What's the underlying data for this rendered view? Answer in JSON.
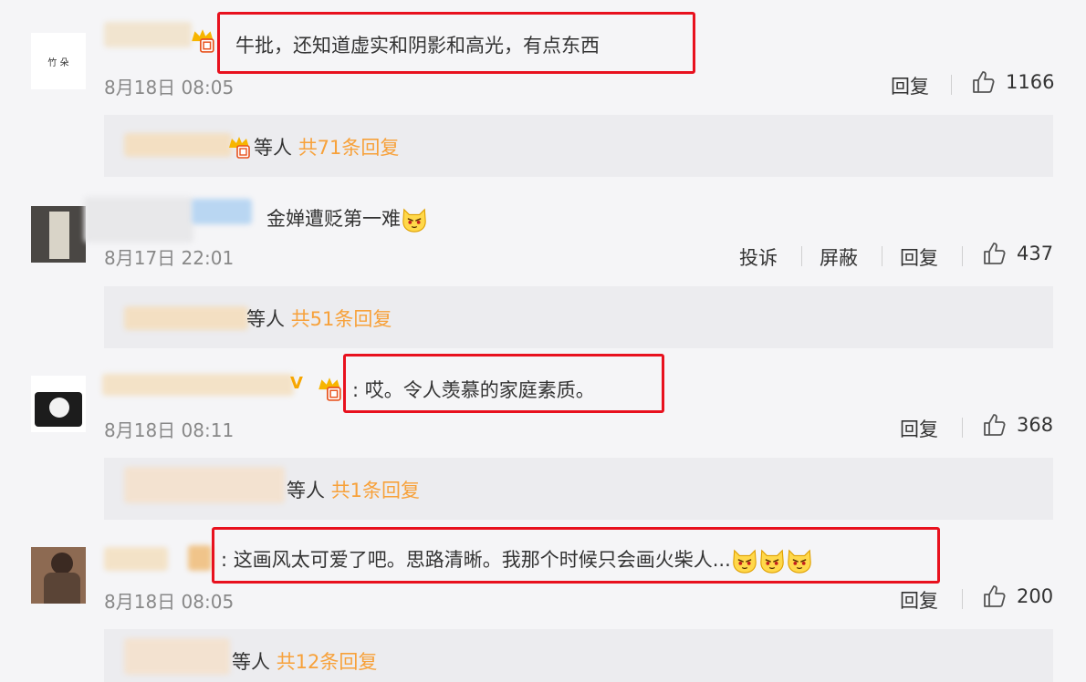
{
  "comments": [
    {
      "text": "牛批，还知道虚实和阴影和高光，有点东西",
      "time": "8月18日 08:05",
      "actions": [
        "回复"
      ],
      "likes": "1166",
      "avatar_text": "竹 朵",
      "sub": {
        "prefix": "等人",
        "count": "共71条回复"
      }
    },
    {
      "text": "金婵遭贬第一难",
      "time": "8月17日 22:01",
      "actions": [
        "投诉",
        "屏蔽",
        "回复"
      ],
      "likes": "437",
      "sub": {
        "prefix": "等人",
        "count": "共51条回复"
      }
    },
    {
      "text": ": 哎。令人羡慕的家庭素质。",
      "time": "8月18日 08:11",
      "actions": [
        "回复"
      ],
      "likes": "368",
      "vip_mark": "V",
      "sub": {
        "prefix": "等人",
        "count": "共1条回复"
      }
    },
    {
      "text": ": 这画风太可爱了吧。思路清晰。我那个时候只会画火柴人...",
      "time": "8月18日 08:05",
      "actions": [
        "回复"
      ],
      "likes": "200",
      "sub": {
        "prefix": "等人",
        "count": "共12条回复"
      }
    }
  ],
  "icons": {
    "like": "thumbs-up-icon",
    "badge": "crown-badge-icon",
    "emoji": "cat-face-emoji-icon"
  },
  "colors": {
    "highlight_box": "#e8111e",
    "reply_count": "#f7a13a",
    "background": "#f5f5f7",
    "reply_bar": "#ececef"
  }
}
